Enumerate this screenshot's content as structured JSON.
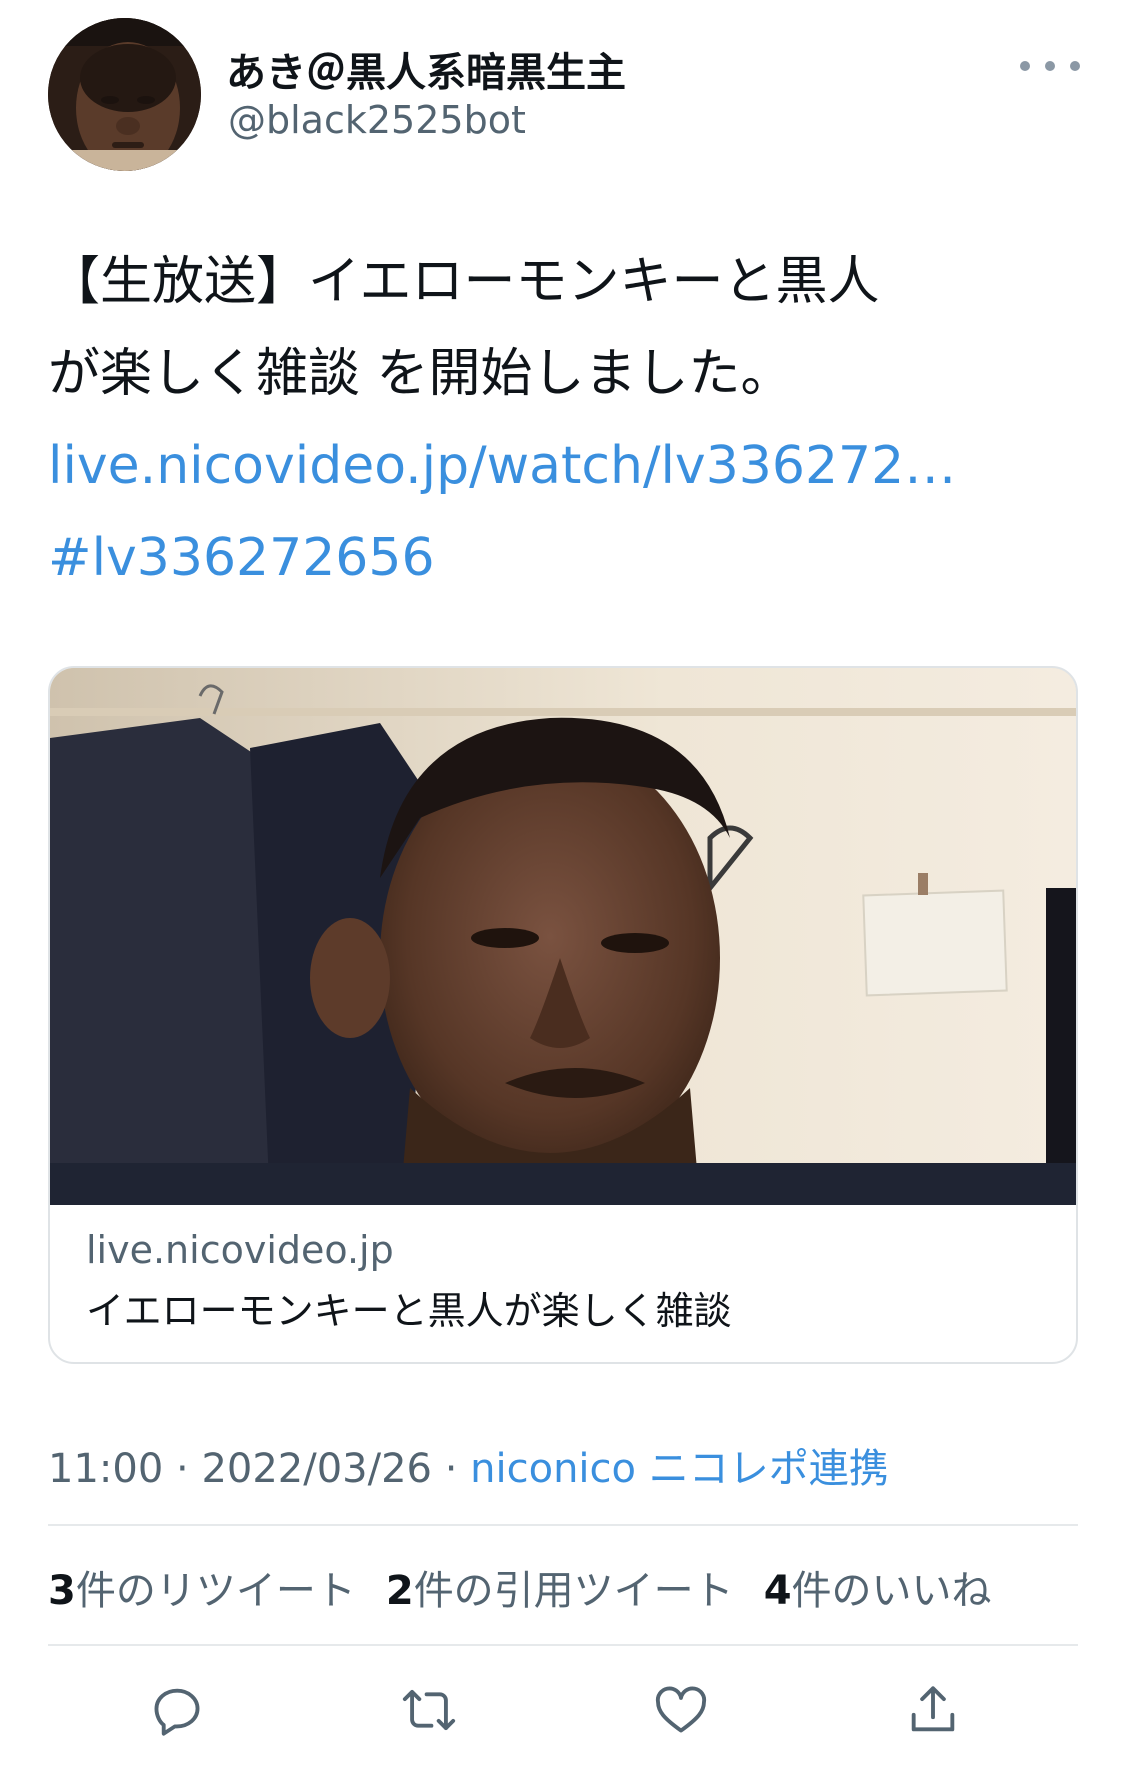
{
  "author": {
    "display_name": "あき＠黒人系暗黒生主",
    "handle": "@black2525bot",
    "avatar_icon": "profile-photo"
  },
  "tweet": {
    "text_line_1": "【生放送】イエローモンキーと黒人",
    "text_line_2": "が楽しく雑談 を開始しました。",
    "link_text": "live.nicovideo.jp/watch/lv336272…",
    "hashtag": "#lv336272656"
  },
  "card": {
    "domain": "live.nicovideo.jp",
    "title": "イエローモンキーと黒人が楽しく雑談"
  },
  "meta": {
    "time": "11:00",
    "separator": "·",
    "date": "2022/03/26",
    "source": "niconico ニコレポ連携"
  },
  "stats": {
    "retweets_count": "3",
    "retweets_label": "件のリツイート",
    "quotes_count": "2",
    "quotes_label": "件の引用ツイート",
    "likes_count": "4",
    "likes_label": "件のいいね"
  },
  "actions": {
    "icons": [
      "reply-icon",
      "retweet-icon",
      "like-icon",
      "share-icon"
    ]
  },
  "colors": {
    "link": "#3a8fde",
    "secondary_text": "#536471",
    "primary_text": "#0f1419"
  }
}
